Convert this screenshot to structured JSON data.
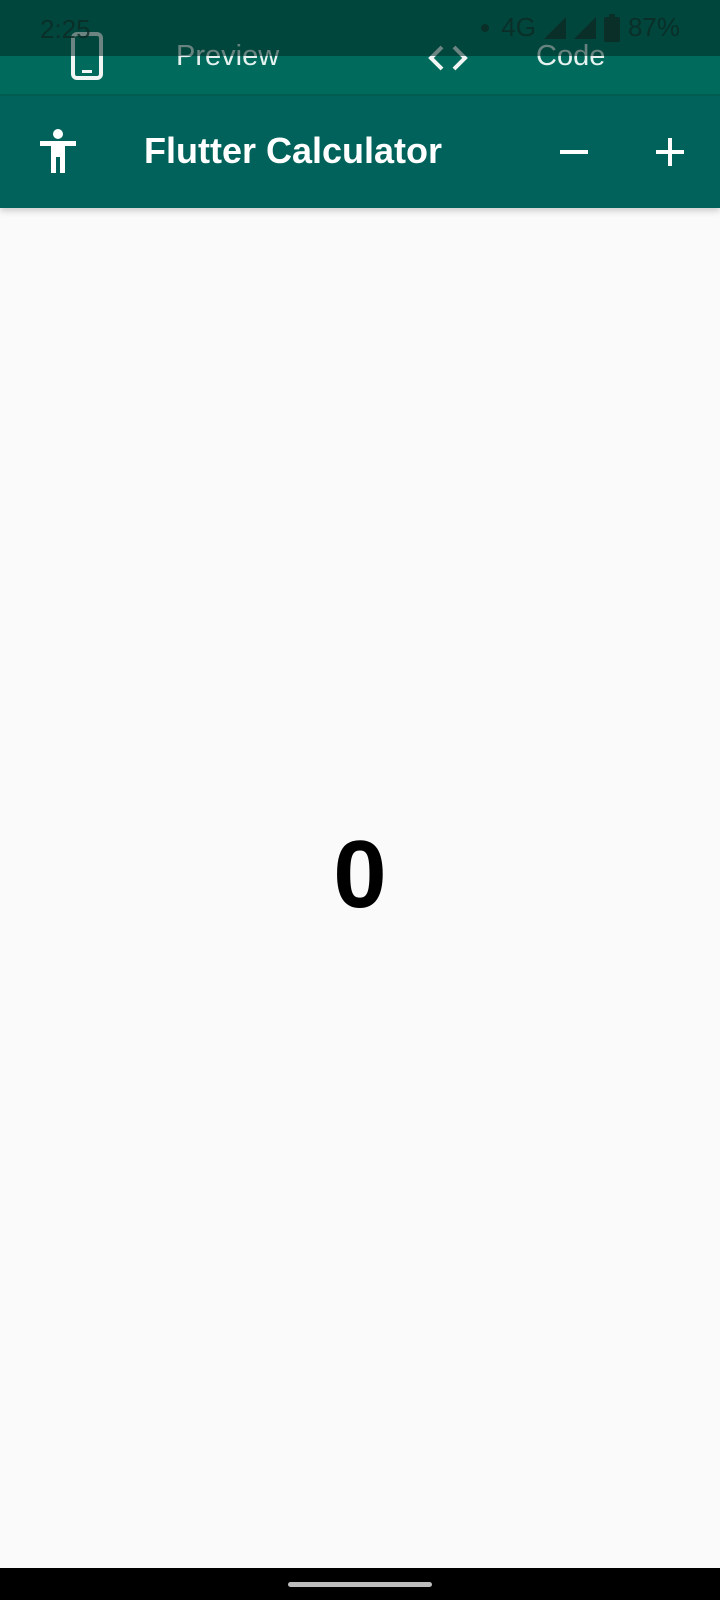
{
  "status_bar": {
    "time": "2:25",
    "network": "4G",
    "battery": "87%"
  },
  "tabs": {
    "preview_label": "Preview",
    "code_label": "Code",
    "preview_icon": "phone-icon",
    "code_icon": "code-brackets-icon"
  },
  "app_bar": {
    "title": "Flutter Calculator",
    "left_icon": "accessibility-icon",
    "right_icons": [
      "minus-icon",
      "plus-icon"
    ]
  },
  "display": {
    "value": "0"
  },
  "colors": {
    "tab_bar": "#006b5c",
    "app_bar": "#00625a",
    "background": "#fafafa",
    "text_on_primary": "#ffffff"
  }
}
